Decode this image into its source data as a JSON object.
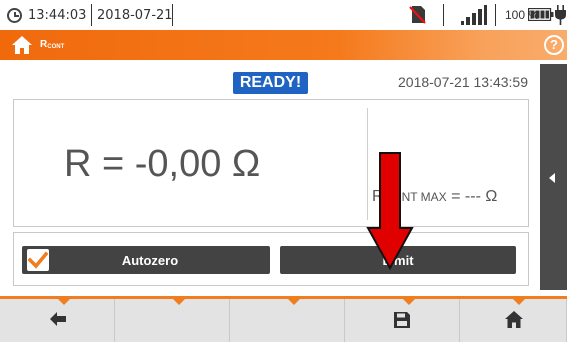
{
  "status_bar": {
    "time": "13:44:03",
    "date": "2018-07-21",
    "battery_percent": "100 %",
    "icons": [
      "clock-icon",
      "no-sim-icon",
      "signal-icon",
      "battery-icon",
      "power-plug-icon"
    ]
  },
  "title_bar": {
    "title_main": "R",
    "title_sub": "CONT",
    "icons": [
      "home-icon",
      "help-icon"
    ],
    "help_symbol": "?",
    "accent_color": "#f06a0c"
  },
  "measurement": {
    "status_badge": "READY!",
    "timestamp": "2018-07-21 13:43:59",
    "result": "R = -0,00 Ω",
    "limit_prefix": "R",
    "limit_sub": "CONT MAX",
    "limit_value": " = --- Ω"
  },
  "buttons": {
    "autozero_label": "Autozero",
    "autozero_checked": true,
    "limit_label": "Limit"
  },
  "bottom_bar": {
    "icons": [
      "back-arrow-icon",
      "empty",
      "empty",
      "save-icon",
      "home-icon"
    ]
  },
  "colors": {
    "badge": "#1f63c3",
    "button": "#434343",
    "annotation_arrow": "#e00000",
    "checkbox_check": "#f07d1e"
  }
}
